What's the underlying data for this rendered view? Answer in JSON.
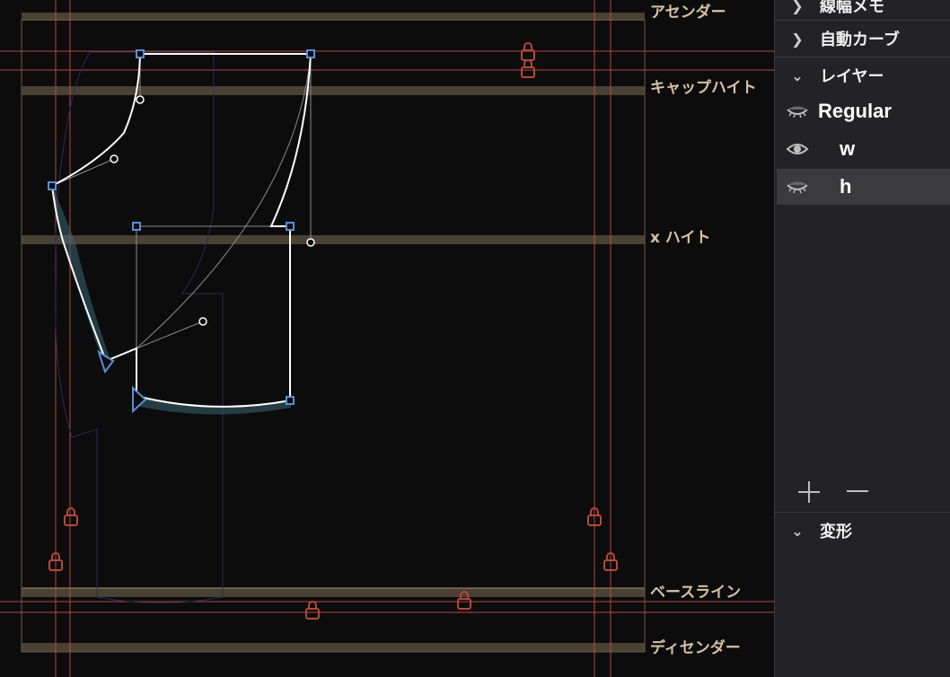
{
  "metrics": {
    "ascender": "アセンダー",
    "cap_height": "キャップハイト",
    "x_height": "x ハイト",
    "baseline": "ベースライン",
    "descender": "ディセンダー"
  },
  "panel": {
    "sections": [
      {
        "label": "線幅メモ",
        "state": "collapsed"
      },
      {
        "label": "自動カーブ",
        "state": "collapsed"
      },
      {
        "label": "レイヤー",
        "state": "expanded"
      }
    ],
    "layers": [
      {
        "name": "Regular",
        "icon": "eye-closed-icon",
        "selected": false
      },
      {
        "name": "w",
        "icon": "eye-open-icon",
        "selected": false
      },
      {
        "name": "h",
        "icon": "eye-closed-icon",
        "selected": true
      }
    ],
    "add_icon": "plus-icon",
    "remove_icon": "minus-icon",
    "transform_section": {
      "label": "変形",
      "state": "expanded"
    }
  },
  "colors": {
    "canvas_bg": "#0c0c0d",
    "panel_bg": "#232325",
    "metric_band": "#4a4034",
    "metric_text": "#d8c3a5",
    "guide_red": "#b5483b",
    "point_blue": "#5a8fd6",
    "outline": "#ffffff"
  }
}
